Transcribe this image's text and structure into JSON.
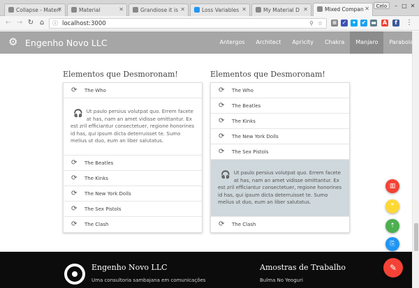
{
  "browser": {
    "tabs": [
      {
        "title": "Collapse - Materi",
        "favicon_color": "#9e9e9e"
      },
      {
        "title": "Material",
        "favicon_color": "#9e9e9e"
      },
      {
        "title": "Grandiose it is",
        "favicon_color": "#9e9e9e"
      },
      {
        "title": "Loss Variables",
        "favicon_color": "#2196f3"
      },
      {
        "title": "My Material D",
        "favicon_color": "#9e9e9e"
      },
      {
        "title": "Mixed Compan",
        "favicon_color": "#9e9e9e"
      }
    ],
    "user": "Celo",
    "url": "localhost:3000"
  },
  "site": {
    "brand": "Engenho Novo LLC",
    "nav": [
      "Antergos",
      "Architect",
      "Apricity",
      "Chakra",
      "Manjaro",
      "Parabola"
    ],
    "active_nav": "Manjaro"
  },
  "left_card": {
    "title": "Elementos que Desmoronam!",
    "top_items": [
      "The Who"
    ],
    "body": "Ut paulo persius volutpat quo. Errem facete at has, nam an amet vidisse omittantur. Ex est zril efficiantur consectetuer, regione honorines id has, qui ipsum dicta deterruisset te. Sumo melius ut duo, eum an liber salutatus.",
    "bottom_items": [
      "The Beatles",
      "The Kinks",
      "The New York Dolls",
      "The Sex Pistols",
      "The Clash"
    ]
  },
  "right_card": {
    "title": "Elementos que Desmoronam!",
    "top_items": [
      "The Who",
      "The Beatles",
      "The Kinks",
      "The New York Dolls",
      "The Sex Pistols"
    ],
    "body": "Ut paulo persius volutpat quo. Errem facete at has, nam an amet vidisse omittantur. Ex est zril efficiantur consectetuer, regione honorines id has, qui ipsum dicta deterruisset te. Sumo melius ut duo, eum an liber salutatus.",
    "bottom_items": [
      "The Clash"
    ]
  },
  "footer": {
    "title": "Engenho Novo LLC",
    "subtitle": "Uma consultoria sambajana em comunicações",
    "title2": "Amostras de Trabalho",
    "subtitle2": "Bulma No Yeoguri"
  },
  "fab": {
    "colors": [
      "#f44336",
      "#fdd835",
      "#4caf50",
      "#2196f3"
    ],
    "main_color": "#f44336"
  }
}
